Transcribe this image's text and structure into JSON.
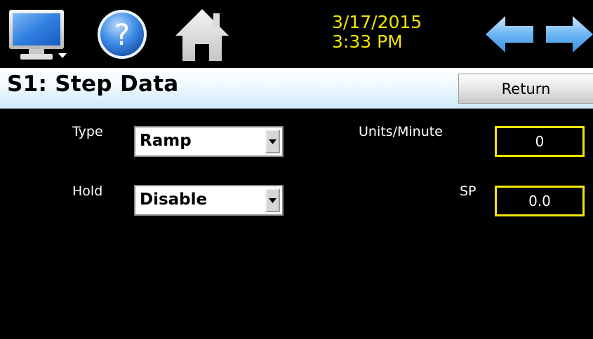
{
  "header": {
    "date": "3/17/2015",
    "time": "3:33 PM",
    "icons": [
      "monitor-icon",
      "help-icon",
      "home-icon",
      "back-arrow-icon",
      "forward-arrow-icon"
    ]
  },
  "page": {
    "title": "S1: Step Data",
    "return_label": "Return"
  },
  "fields": {
    "type": {
      "label": "Type",
      "value": "Ramp"
    },
    "hold": {
      "label": "Hold",
      "value": "Disable"
    },
    "units_per_minute": {
      "label": "Units/Minute",
      "value": "0"
    },
    "sp": {
      "label": "SP",
      "value": "0.0"
    }
  },
  "colors": {
    "accent_yellow": "#f2e600",
    "background": "#000000",
    "title_bar": "#cfeaf9",
    "arrow_blue": "#4aa8f2"
  }
}
